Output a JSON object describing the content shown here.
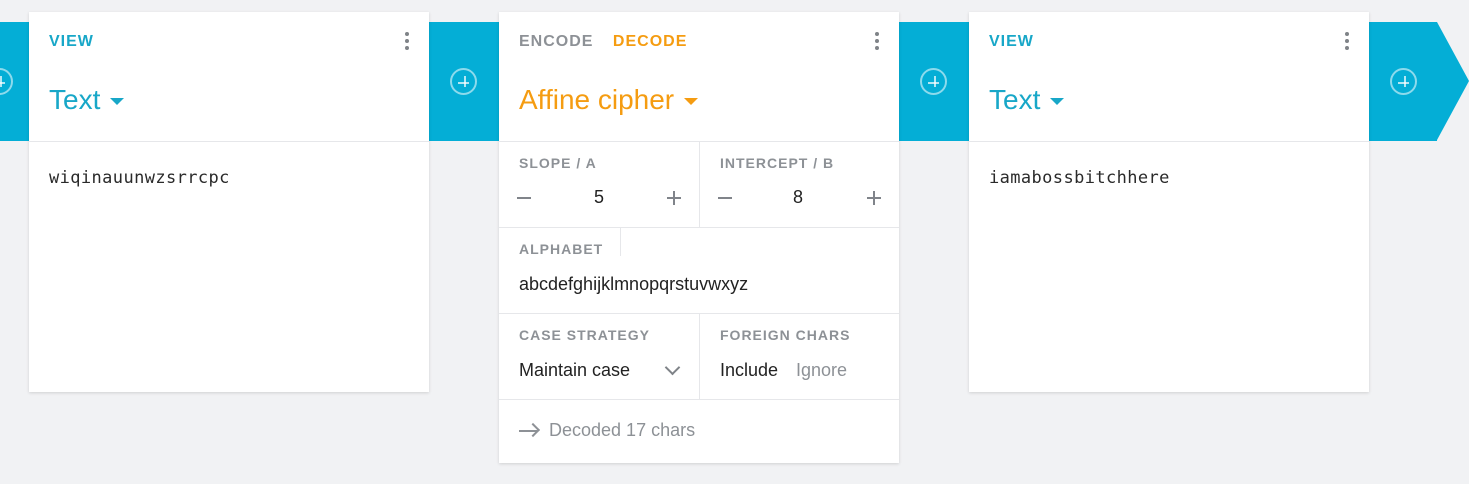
{
  "view_card_1": {
    "tab_label": "VIEW",
    "format": "Text",
    "content": "wiqinauunwzsrrcpc"
  },
  "cipher_card": {
    "tab_encode": "ENCODE",
    "tab_decode": "DECODE",
    "active_tab": "DECODE",
    "title": "Affine cipher",
    "slope": {
      "label": "SLOPE / A",
      "value": "5"
    },
    "intercept": {
      "label": "INTERCEPT / B",
      "value": "8"
    },
    "alphabet": {
      "label": "ALPHABET",
      "value": "abcdefghijklmnopqrstuvwxyz"
    },
    "case_strategy": {
      "label": "CASE STRATEGY",
      "value": "Maintain case"
    },
    "foreign_chars": {
      "label": "FOREIGN CHARS",
      "option_include": "Include",
      "option_ignore": "Ignore",
      "selected": "Include"
    },
    "status": "Decoded 17 chars"
  },
  "view_card_2": {
    "tab_label": "VIEW",
    "format": "Text",
    "content": "iamabossbitchhere"
  },
  "colors": {
    "pipe": "#04aed6",
    "view_accent": "#18a7c8",
    "cipher_accent": "#f59c11",
    "background": "#f1f2f4"
  },
  "icons": [
    "add-circle-icon",
    "more-vert-icon",
    "caret-down-icon",
    "minus-icon",
    "plus-icon",
    "chevron-down-icon",
    "arrow-right-icon"
  ]
}
